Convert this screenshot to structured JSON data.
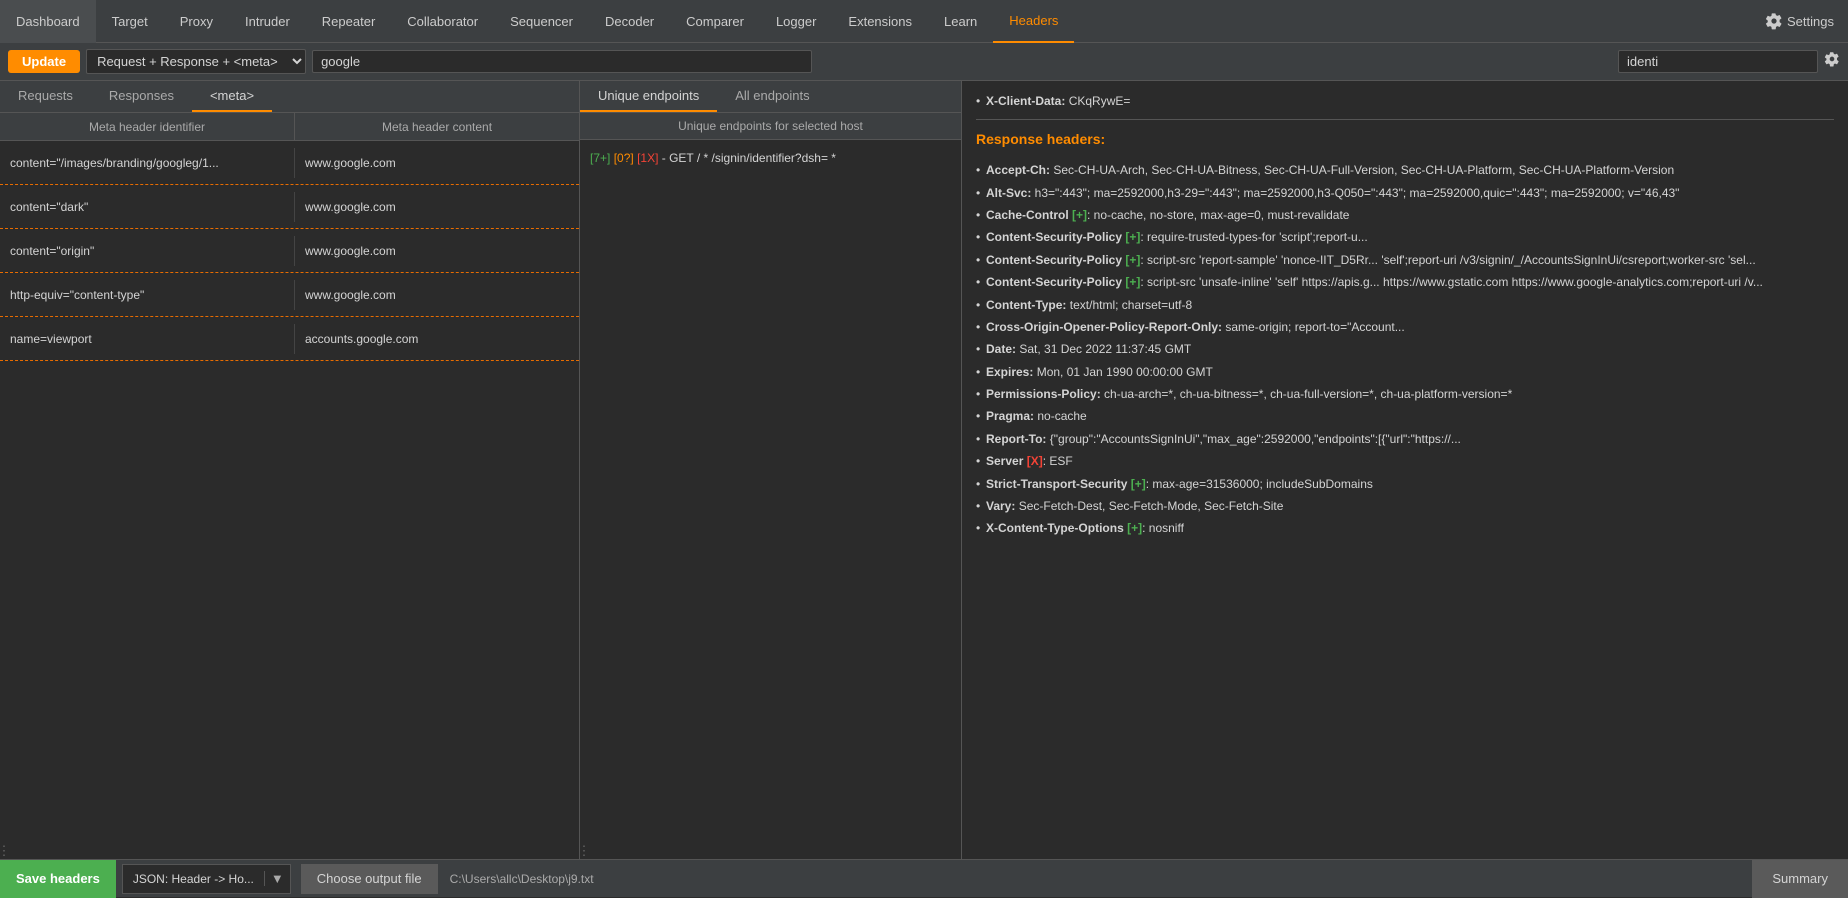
{
  "nav": {
    "items": [
      {
        "label": "Dashboard",
        "active": false
      },
      {
        "label": "Target",
        "active": false
      },
      {
        "label": "Proxy",
        "active": false
      },
      {
        "label": "Intruder",
        "active": false
      },
      {
        "label": "Repeater",
        "active": false
      },
      {
        "label": "Collaborator",
        "active": false
      },
      {
        "label": "Sequencer",
        "active": false
      },
      {
        "label": "Decoder",
        "active": false
      },
      {
        "label": "Comparer",
        "active": false
      },
      {
        "label": "Logger",
        "active": false
      },
      {
        "label": "Extensions",
        "active": false
      },
      {
        "label": "Learn",
        "active": false
      },
      {
        "label": "Headers",
        "active": true
      }
    ],
    "settings_label": "Settings"
  },
  "toolbar": {
    "update_label": "Update",
    "filter_value": "Request + Response + <meta>",
    "host_value": "google",
    "search_value": "identi"
  },
  "left_tabs": {
    "items": [
      {
        "label": "Requests",
        "active": false
      },
      {
        "label": "Responses",
        "active": false
      },
      {
        "label": "<meta>",
        "active": true
      }
    ]
  },
  "table": {
    "col_identifier": "Meta header identifier",
    "col_content": "Meta header content",
    "rows": [
      {
        "identifier": "content=\"/images/branding/googleg/1...",
        "content": "www.google.com"
      },
      {
        "identifier": "content=\"dark\"",
        "content": "www.google.com"
      },
      {
        "identifier": "content=\"origin\"",
        "content": "www.google.com"
      },
      {
        "identifier": "http-equiv=\"content-type\"",
        "content": "www.google.com"
      },
      {
        "identifier": "name=viewport",
        "content": "accounts.google.com"
      }
    ]
  },
  "middle": {
    "tabs": [
      {
        "label": "Unique endpoints",
        "active": true
      },
      {
        "label": "All endpoints",
        "active": false
      }
    ],
    "subtitle": "Unique endpoints for selected host",
    "endpoints": [
      {
        "badge_green": "[7+]",
        "badge_yellow": "[0?]",
        "badge_red": "[1X]",
        "method": "- GET / * /signin/identifier?dsh= *"
      }
    ]
  },
  "right": {
    "x_client_label": "X-Client-Data:",
    "x_client_value": "CKqRywE=",
    "response_title": "Response headers:",
    "headers": [
      {
        "key": "Accept-Ch:",
        "value": " Sec-CH-UA-Arch, Sec-CH-UA-Bitness, Sec-CH-UA-Full-Version, Sec-CH-UA-Platform, Sec-CH-UA-Platform-Version"
      },
      {
        "key": "Alt-Svc:",
        "value": " h3=\":443\"; ma=2592000,h3-29=\":443\"; ma=2592000,h3-Q050=\":443\"; ma=2592000,quic=\":443\"; ma=2592000; v=\"46,43\""
      },
      {
        "key": "Cache-Control",
        "badge": "[+]",
        "badge_color": "green",
        "value": ": no-cache, no-store, max-age=0, must-revalidate"
      },
      {
        "key": "Content-Security-Policy",
        "badge": "[+]",
        "badge_color": "green",
        "value": ": require-trusted-types-for 'script';report-u..."
      },
      {
        "key": "Content-Security-Policy",
        "badge": "[+]",
        "badge_color": "green",
        "value": ": script-src 'report-sample' 'nonce-IIT_D5Rr... 'self';report-uri /v3/signin/_/AccountsSignInUi/csreport;worker-src 'sel..."
      },
      {
        "key": "Content-Security-Policy",
        "badge": "[+]",
        "badge_color": "green",
        "value": ": script-src 'unsafe-inline' 'self' https://apis.g... https://www.gstatic.com https://www.google-analytics.com;report-uri /v..."
      },
      {
        "key": "Content-Type:",
        "value": " text/html; charset=utf-8"
      },
      {
        "key": "Cross-Origin-Opener-Policy-Report-Only:",
        "value": " same-origin; report-to=\"Account..."
      },
      {
        "key": "Date:",
        "value": " Sat, 31 Dec 2022 11:37:45 GMT"
      },
      {
        "key": "Expires:",
        "value": " Mon, 01 Jan 1990 00:00:00 GMT"
      },
      {
        "key": "Permissions-Policy:",
        "value": " ch-ua-arch=*, ch-ua-bitness=*, ch-ua-full-version=*, ch-ua-platform-version=*"
      },
      {
        "key": "Pragma:",
        "value": " no-cache"
      },
      {
        "key": "Report-To:",
        "value": " {\"group\":\"AccountsSignInUi\",\"max_age\":2592000,\"endpoints\":[{\"url\":\"https://..."
      },
      {
        "key": "Server",
        "badge": "[X]",
        "badge_color": "red",
        "value": ": ESF"
      },
      {
        "key": "Strict-Transport-Security",
        "badge": "[+]",
        "badge_color": "green",
        "value": ": max-age=31536000; includeSubDomains"
      },
      {
        "key": "Vary:",
        "value": " Sec-Fetch-Dest, Sec-Fetch-Mode, Sec-Fetch-Site"
      },
      {
        "key": "X-Content-Type-Options",
        "badge": "[+]",
        "badge_color": "green",
        "value": ": nosniff"
      }
    ]
  },
  "bottom": {
    "save_label": "Save headers",
    "format_label": "JSON: Header -> Ho...",
    "choose_file_label": "Choose output file",
    "filepath": "C:\\Users\\allc\\Desktop\\j9.txt",
    "summary_label": "Summary"
  }
}
